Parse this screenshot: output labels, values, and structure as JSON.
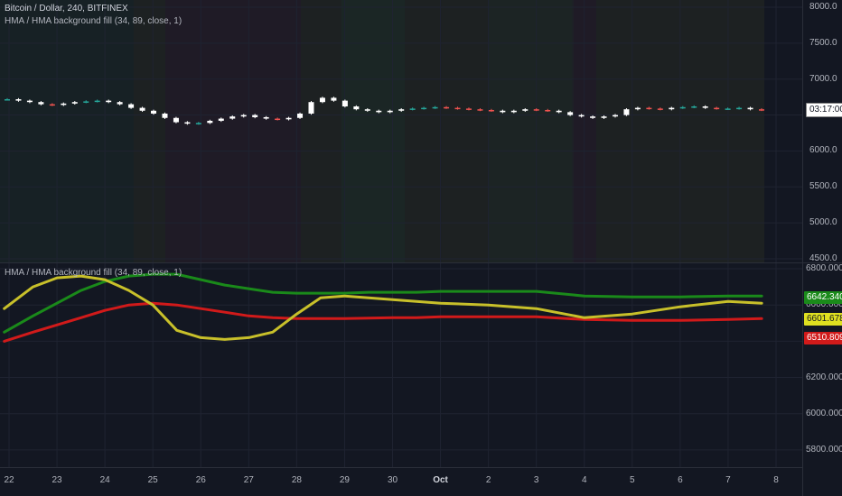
{
  "colors": {
    "background": "#131722",
    "grid": "#1f2331",
    "divider": "#2a2e39",
    "up_candle": "#26a69a",
    "down_candle": "#ef5350",
    "body_candle": "#ffffff",
    "green_line": "#1a8a1a",
    "red_line": "#d11a1a",
    "yellow_line": "#c8c02a",
    "bg_green_tint": "#1b2a28",
    "bg_yellow_tint": "#262a22",
    "bg_red_tint": "#2a1f2a"
  },
  "main_pane": {
    "symbol_label": "Bitcoin / Dollar, 240, BITFINEX",
    "indicator_label": "HMA / HMA background fill (34, 89, close, 1)",
    "price_badge": "03:17:00",
    "y_ticks": [
      "8000.0",
      "7500.0",
      "7000.0",
      "6500.0",
      "6000.0",
      "5500.0",
      "5000.0",
      "4500.0"
    ]
  },
  "sub_pane": {
    "indicator_label": "HMA / HMA background fill (34, 89, close, 1)",
    "y_ticks": [
      "6800.0000",
      "6600.0000",
      "6400.0000",
      "6200.0000",
      "6000.0000",
      "5800.0000"
    ],
    "badges": [
      {
        "text": "6642.3405",
        "bg": "#1a8a1a",
        "fg": "#ffffff"
      },
      {
        "text": "6601.6788",
        "bg": "#e0e020",
        "fg": "#131722"
      },
      {
        "text": "6510.8090",
        "bg": "#d11a1a",
        "fg": "#ffffff"
      }
    ]
  },
  "x_axis": {
    "labels": [
      "22",
      "23",
      "24",
      "25",
      "26",
      "27",
      "28",
      "29",
      "30",
      "Oct",
      "2",
      "3",
      "4",
      "5",
      "6",
      "7",
      "8"
    ]
  },
  "chart_data": [
    {
      "type": "candlestick",
      "title": "Bitcoin / Dollar, 240, BITFINEX",
      "ylim": [
        4450,
        8100
      ],
      "x_range_days": [
        21.9,
        8.8
      ],
      "close_series": [
        6720,
        6700,
        6680,
        6650,
        6640,
        6660,
        6680,
        6690,
        6700,
        6680,
        6650,
        6600,
        6560,
        6520,
        6460,
        6400,
        6380,
        6390,
        6420,
        6450,
        6480,
        6500,
        6470,
        6450,
        6440,
        6460,
        6520,
        6680,
        6740,
        6700,
        6620,
        6580,
        6560,
        6540,
        6560,
        6580,
        6590,
        6600,
        6610,
        6600,
        6590,
        6580,
        6570,
        6560,
        6540,
        6560,
        6580,
        6570,
        6560,
        6540,
        6500,
        6480,
        6460,
        6480,
        6500,
        6580,
        6600,
        6590,
        6580,
        6600,
        6610,
        6620,
        6600,
        6590,
        6590,
        6600,
        6580,
        6570
      ]
    },
    {
      "type": "line",
      "title": "HMA / HMA background fill (34, 89, close, 1)",
      "ylim": [
        5700,
        6830
      ],
      "x_range_days": [
        21.9,
        8.8
      ],
      "series": [
        {
          "name": "",
          "color": "#1a8a1a",
          "x": [
            21.9,
            22.5,
            23.0,
            23.5,
            24.0,
            24.5,
            25.0,
            25.5,
            26.0,
            26.5,
            27.0,
            27.5,
            28.0,
            28.5,
            29.0,
            29.5,
            30.0,
            30.5,
            31.0,
            32.0,
            33.0,
            34.0,
            35.0,
            36.0,
            37.0,
            37.7
          ],
          "values": [
            6450,
            6540,
            6610,
            6680,
            6730,
            6760,
            6770,
            6770,
            6740,
            6710,
            6690,
            6670,
            6665,
            6665,
            6665,
            6670,
            6670,
            6670,
            6675,
            6675,
            6675,
            6650,
            6645,
            6645,
            6650,
            6650
          ]
        },
        {
          "name": "",
          "color": "#d11a1a",
          "x": [
            21.9,
            22.5,
            23.0,
            23.5,
            24.0,
            24.5,
            25.0,
            25.5,
            26.0,
            26.5,
            27.0,
            27.5,
            28.0,
            28.5,
            29.0,
            29.5,
            30.0,
            30.5,
            31.0,
            32.0,
            33.0,
            34.0,
            35.0,
            36.0,
            37.0,
            37.7
          ],
          "values": [
            6400,
            6450,
            6490,
            6530,
            6570,
            6600,
            6610,
            6600,
            6580,
            6560,
            6540,
            6530,
            6525,
            6525,
            6525,
            6528,
            6530,
            6530,
            6535,
            6535,
            6535,
            6520,
            6515,
            6515,
            6520,
            6525
          ]
        },
        {
          "name": "",
          "color": "#c8c02a",
          "x": [
            21.9,
            22.5,
            23.0,
            23.5,
            24.0,
            24.5,
            25.0,
            25.5,
            26.0,
            26.5,
            27.0,
            27.5,
            28.0,
            28.5,
            29.0,
            29.5,
            30.0,
            30.5,
            31.0,
            32.0,
            33.0,
            34.0,
            35.0,
            36.0,
            37.0,
            37.7
          ],
          "values": [
            6580,
            6700,
            6750,
            6760,
            6740,
            6680,
            6600,
            6460,
            6420,
            6410,
            6420,
            6450,
            6550,
            6640,
            6650,
            6640,
            6630,
            6620,
            6610,
            6600,
            6580,
            6530,
            6550,
            6590,
            6620,
            6610
          ]
        }
      ]
    }
  ]
}
